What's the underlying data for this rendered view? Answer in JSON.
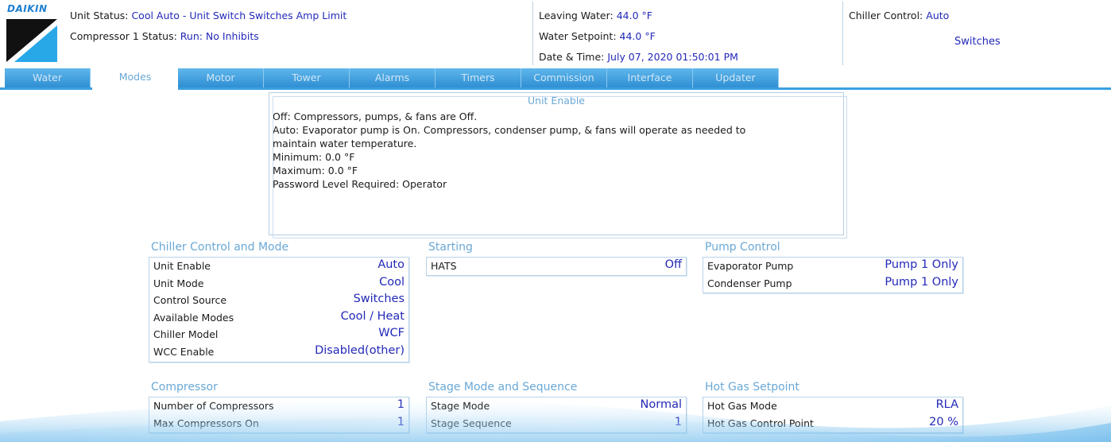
{
  "brand": {
    "logo_text": "DAIKIN"
  },
  "header": {
    "unit_status_label": "Unit Status:",
    "unit_status_value": "Cool Auto - Unit Switch  Switches Amp Limit",
    "compressor_status_label": "Compressor 1 Status:",
    "compressor_status_value": "Run: No Inhibits",
    "leaving_water_label": "Leaving Water:",
    "leaving_water_value": "44.0 °F",
    "water_setpoint_label": "Water Setpoint:",
    "water_setpoint_value": "44.0 °F",
    "datetime_label": "Date & Time:",
    "datetime_value": "July 07, 2020  01:50:01 PM",
    "chiller_control_label": "Chiller Control:",
    "chiller_control_value": "Auto",
    "chiller_control_source": "Switches"
  },
  "tabs": [
    {
      "label": "Water",
      "active": false
    },
    {
      "label": "Modes",
      "active": true
    },
    {
      "label": "Motor",
      "active": false
    },
    {
      "label": "Tower",
      "active": false
    },
    {
      "label": "Alarms",
      "active": false
    },
    {
      "label": "Timers",
      "active": false
    },
    {
      "label": "Commission",
      "active": false
    },
    {
      "label": "Interface",
      "active": false
    },
    {
      "label": "Updater",
      "active": false
    }
  ],
  "unit_enable_info": {
    "title": "Unit Enable",
    "lines": [
      "Off: Compressors, pumps, & fans are Off.",
      "Auto:  Evaporator pump is On. Compressors, condenser pump, & fans will operate as needed to",
      "maintain water temperature.",
      "Minimum: 0.0 °F",
      "Maximum: 0.0 °F",
      "Password Level Required: Operator"
    ]
  },
  "panels": {
    "chiller_control_mode": {
      "title": "Chiller Control and Mode",
      "rows": [
        {
          "label": "Unit Enable",
          "value": "Auto"
        },
        {
          "label": "Unit Mode",
          "value": "Cool"
        },
        {
          "label": "Control Source",
          "value": "Switches"
        },
        {
          "label": "Available Modes",
          "value": "Cool / Heat"
        },
        {
          "label": "Chiller Model",
          "value": "WCF"
        },
        {
          "label": "WCC Enable",
          "value": "Disabled(other)"
        }
      ]
    },
    "starting": {
      "title": "Starting",
      "rows": [
        {
          "label": "HATS",
          "value": "Off"
        }
      ]
    },
    "pump_control": {
      "title": "Pump Control",
      "rows": [
        {
          "label": "Evaporator Pump",
          "value": "Pump 1 Only"
        },
        {
          "label": "Condenser Pump",
          "value": "Pump 1 Only"
        }
      ]
    },
    "compressor": {
      "title": "Compressor",
      "rows": [
        {
          "label": "Number of Compressors",
          "value": "1"
        },
        {
          "label": "Max Compressors On",
          "value": "1"
        }
      ]
    },
    "stage_mode": {
      "title": "Stage Mode and Sequence",
      "rows": [
        {
          "label": "Stage Mode",
          "value": "Normal"
        },
        {
          "label": "Stage Sequence",
          "value": "1"
        }
      ]
    },
    "hot_gas": {
      "title": "Hot Gas Setpoint",
      "rows": [
        {
          "label": "Hot Gas Mode",
          "value": "RLA"
        },
        {
          "label": "Hot Gas Control Point",
          "value": "20 %"
        }
      ]
    }
  },
  "colors": {
    "accent_blue": "#2329b8",
    "title_blue": "#6aa8d6",
    "tab_blue": "#3aa0e0"
  }
}
